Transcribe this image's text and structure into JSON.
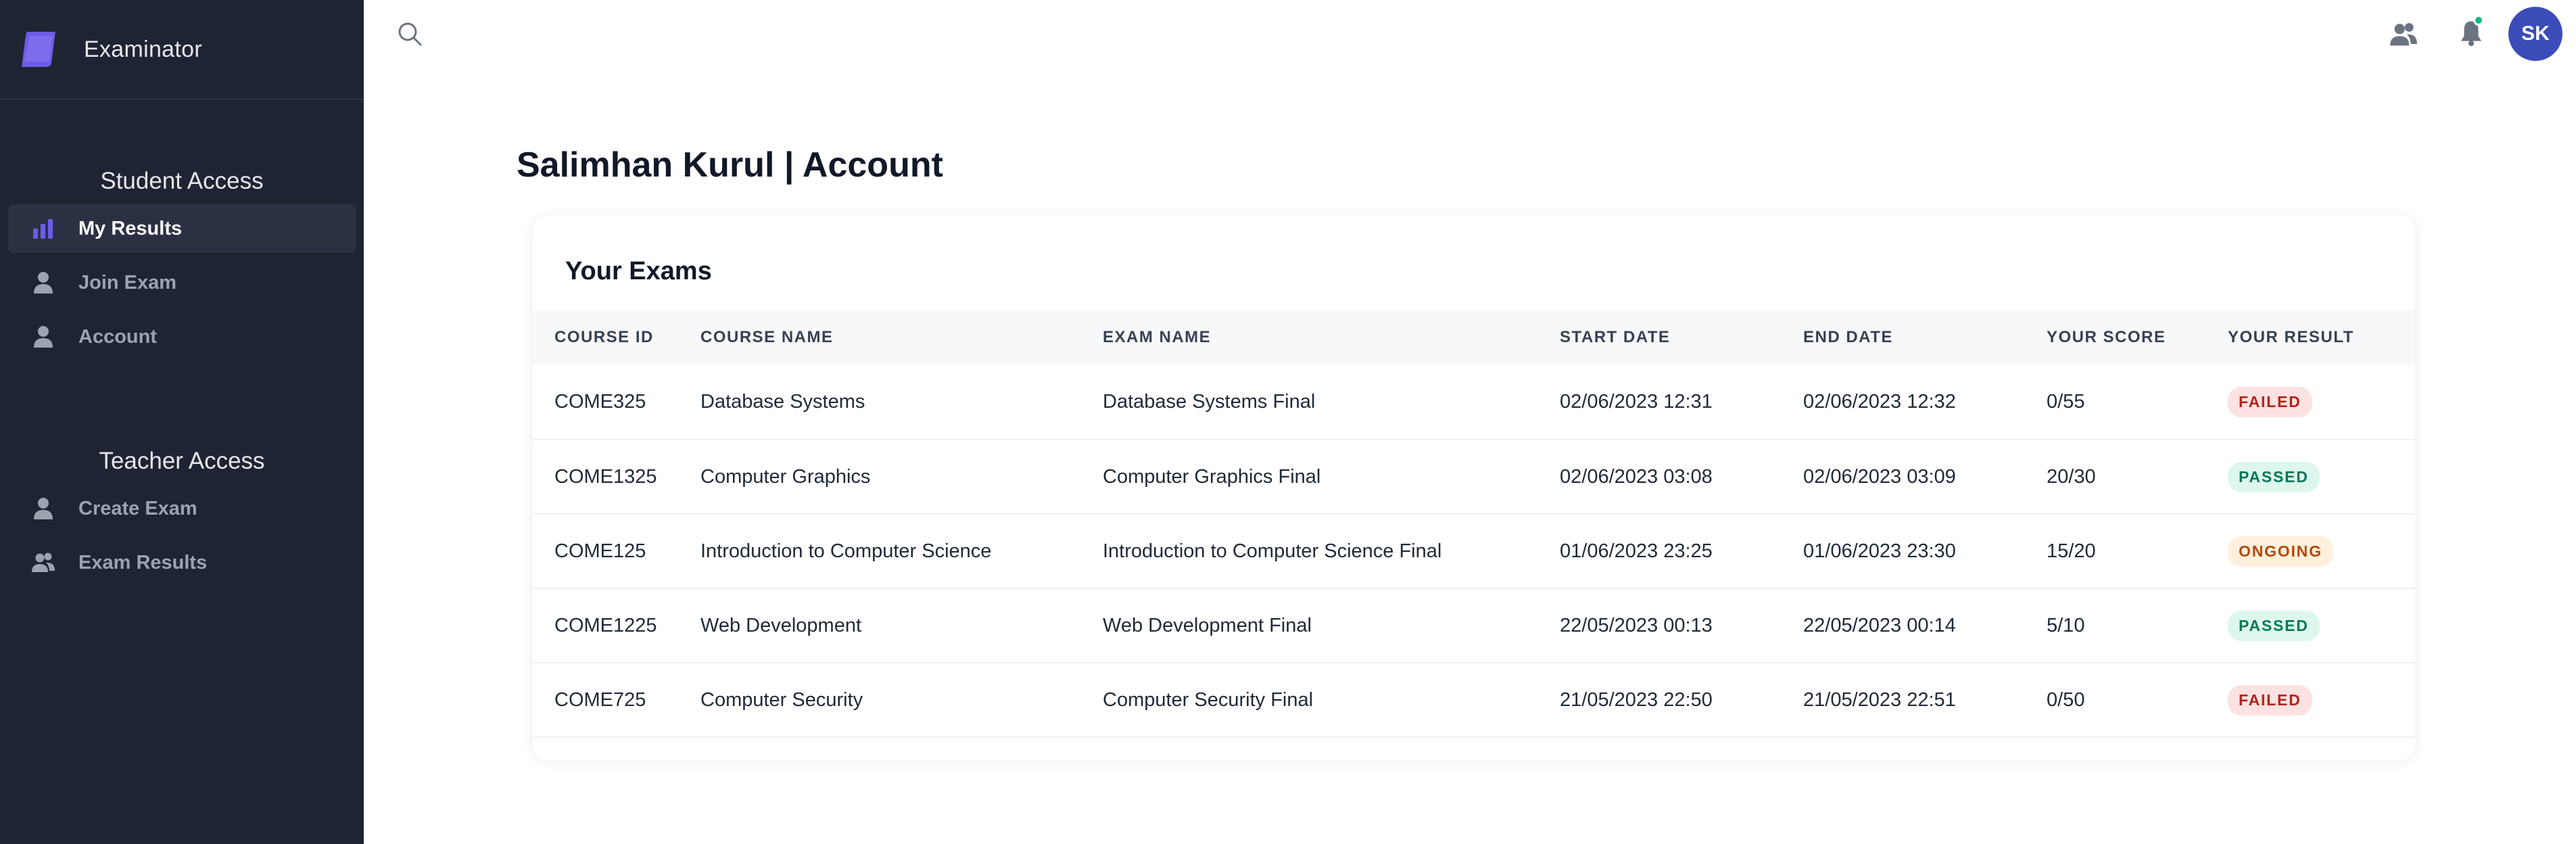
{
  "app": {
    "name": "Examinator"
  },
  "sidebar": {
    "sections": [
      {
        "title": "Student Access",
        "items": [
          {
            "label": "My Results",
            "icon": "bar-chart-icon",
            "active": true
          },
          {
            "label": "Join Exam",
            "icon": "user-icon",
            "active": false
          },
          {
            "label": "Account",
            "icon": "user-icon",
            "active": false
          }
        ]
      },
      {
        "title": "Teacher Access",
        "items": [
          {
            "label": "Create Exam",
            "icon": "user-icon",
            "active": false
          },
          {
            "label": "Exam Results",
            "icon": "users-icon",
            "active": false
          }
        ]
      }
    ]
  },
  "topbar": {
    "search_icon": "search-icon",
    "people_icon": "users-icon",
    "bell_icon": "bell-icon",
    "avatar_initials": "SK"
  },
  "main": {
    "title": "Salimhan Kurul | Account",
    "card_title": "Your Exams",
    "table": {
      "headers": [
        "COURSE ID",
        "COURSE NAME",
        "EXAM NAME",
        "START DATE",
        "END DATE",
        "YOUR SCORE",
        "YOUR RESULT"
      ],
      "rows": [
        {
          "course_id": "COME325",
          "course_name": "Database Systems",
          "exam_name": "Database Systems Final",
          "start": "02/06/2023 12:31",
          "end": "02/06/2023 12:32",
          "score": "0/55",
          "result": "FAILED"
        },
        {
          "course_id": "COME1325",
          "course_name": "Computer Graphics",
          "exam_name": "Computer Graphics Final",
          "start": "02/06/2023 03:08",
          "end": "02/06/2023 03:09",
          "score": "20/30",
          "result": "PASSED"
        },
        {
          "course_id": "COME125",
          "course_name": "Introduction to Computer Science",
          "exam_name": "Introduction to Computer Science Final",
          "start": "01/06/2023 23:25",
          "end": "01/06/2023 23:30",
          "score": "15/20",
          "result": "ONGOING"
        },
        {
          "course_id": "COME1225",
          "course_name": "Web Development",
          "exam_name": "Web Development Final",
          "start": "22/05/2023 00:13",
          "end": "22/05/2023 00:14",
          "score": "5/10",
          "result": "PASSED"
        },
        {
          "course_id": "COME725",
          "course_name": "Computer Security",
          "exam_name": "Computer Security Final",
          "start": "21/05/2023 22:50",
          "end": "21/05/2023 22:51",
          "score": "0/50",
          "result": "FAILED"
        }
      ]
    }
  },
  "colors": {
    "sidebar_bg": "#1f2433",
    "accent": "#6d5ce7",
    "avatar_bg": "#3b4cb8",
    "failed_bg": "#fde2e2",
    "failed_text": "#b42318",
    "passed_bg": "#def7ec",
    "passed_text": "#047857",
    "ongoing_bg": "#fdf0dc",
    "ongoing_text": "#b54708"
  }
}
